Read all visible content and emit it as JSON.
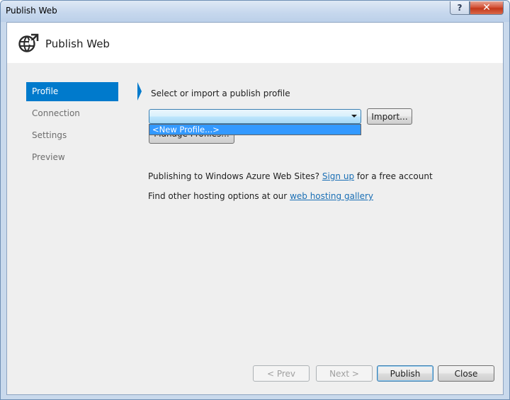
{
  "window": {
    "title": "Publish Web",
    "help_label": "?",
    "close_label": "✕"
  },
  "header": {
    "icon": "globe-publish-icon",
    "title": "Publish Web"
  },
  "nav": {
    "items": [
      {
        "label": "Profile",
        "active": true
      },
      {
        "label": "Connection",
        "active": false
      },
      {
        "label": "Settings",
        "active": false
      },
      {
        "label": "Preview",
        "active": false
      }
    ]
  },
  "profile": {
    "prompt": "Select or import a publish profile",
    "combo_value": "",
    "import_label": "Import...",
    "manage_label": "Manage Profiles...",
    "dropdown_options": [
      "<New Profile...>"
    ],
    "azure_text": "Publishing to Windows Azure Web Sites?",
    "signup_link": "Sign up",
    "azure_suffix": "for a free account",
    "hosting_text": "Find other hosting options at our",
    "hosting_link": "web hosting gallery"
  },
  "footer": {
    "prev_label": "< Prev",
    "next_label": "Next >",
    "publish_label": "Publish",
    "close_label": "Close"
  },
  "colors": {
    "accent": "#007acc",
    "selection": "#3399ff",
    "link": "#1a6fb5"
  }
}
